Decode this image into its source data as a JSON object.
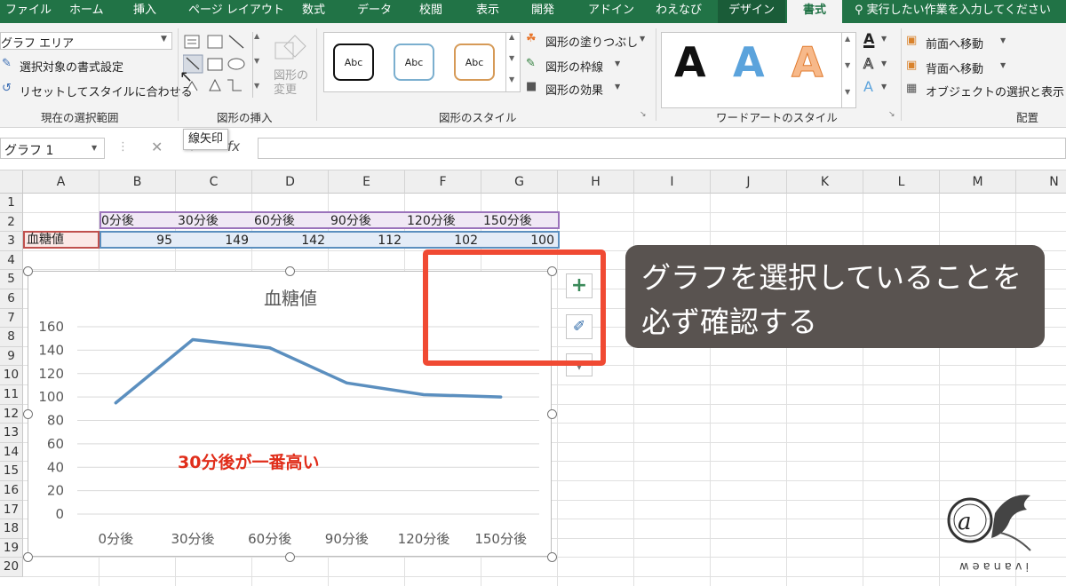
{
  "ribbon": {
    "tabs": [
      "ファイル",
      "ホーム",
      "挿入",
      "ページ レイアウト",
      "数式",
      "データ",
      "校閲",
      "表示",
      "開発",
      "アドイン",
      "わえなび",
      "デザイン",
      "書式"
    ],
    "tell_me": "実行したい作業を入力してください",
    "selection_group": {
      "dropdown_value": "グラフ エリア",
      "format_selection": "選択対象の書式設定",
      "reset_style": "リセットしてスタイルに合わせる",
      "label": "現在の選択範囲"
    },
    "insert_shapes": {
      "change_shape": "図形の\n変更",
      "label": "図形の挿入",
      "tooltip": "線矢印"
    },
    "shape_styles": {
      "sample": "Abc",
      "fill": "図形の塗りつぶし",
      "outline": "図形の枠線",
      "effects": "図形の効果",
      "label": "図形のスタイル"
    },
    "wordart": {
      "sample": "A",
      "label": "ワードアートのスタイル"
    },
    "arrange": {
      "bring_forward": "前面へ移動",
      "send_backward": "背面へ移動",
      "selection_pane": "オブジェクトの選択と表示",
      "label": "配置"
    }
  },
  "formula_bar": {
    "name_box": "グラフ 1",
    "fx": "fx"
  },
  "sheet": {
    "columns": [
      "A",
      "B",
      "C",
      "D",
      "E",
      "F",
      "G",
      "H",
      "I",
      "J",
      "K",
      "L",
      "M",
      "N"
    ],
    "rows": [
      "1",
      "2",
      "3",
      "4",
      "5",
      "6",
      "7",
      "8",
      "9",
      "10",
      "11",
      "12",
      "13",
      "14",
      "15",
      "16",
      "17",
      "18",
      "19",
      "20"
    ],
    "headers_row2": [
      "0分後",
      "30分後",
      "60分後",
      "90分後",
      "120分後",
      "150分後"
    ],
    "row3_label": "血糖値",
    "row3_values": [
      "95",
      "149",
      "142",
      "112",
      "102",
      "100"
    ]
  },
  "annotation": {
    "callout_line1": "グラフを選択していることを",
    "callout_line2": "必ず確認する",
    "chart_note": "30分後が一番高い",
    "highlight_color": "#f04a33",
    "callout_bg": "#595350"
  },
  "watermark": {
    "text": "ivanaew"
  },
  "chart_data": {
    "type": "line",
    "title": "血糖値",
    "categories": [
      "0分後",
      "30分後",
      "60分後",
      "90分後",
      "120分後",
      "150分後"
    ],
    "values": [
      95,
      149,
      142,
      112,
      102,
      100
    ],
    "ylim": [
      0,
      160
    ],
    "yticks": [
      "160",
      "140",
      "120",
      "100",
      "80",
      "60",
      "40",
      "20",
      "0"
    ],
    "series_color": "#5b8fbf",
    "grid": true
  }
}
